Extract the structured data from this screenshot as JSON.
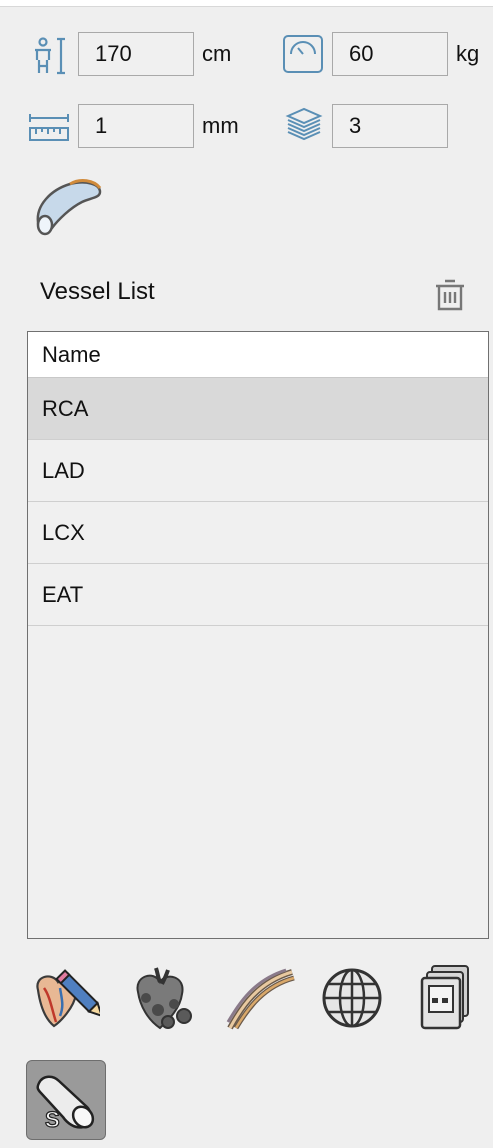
{
  "measurements": {
    "height": {
      "value": "170",
      "unit": "cm"
    },
    "weight": {
      "value": "60",
      "unit": "kg"
    },
    "slice_thickness": {
      "value": "1",
      "unit": "mm"
    },
    "layers": {
      "value": "3"
    }
  },
  "vessel_list": {
    "title": "Vessel List",
    "column_header": "Name",
    "rows": [
      "RCA",
      "LAD",
      "LCX",
      "EAT"
    ],
    "selected_index": 0
  },
  "icons": {
    "height": "body-height-icon",
    "weight": "scale-weight-icon",
    "thickness": "ruler-thickness-icon",
    "layers": "layers-stack-icon",
    "vessel": "vessel-tube-icon",
    "delete": "trash-icon",
    "toolbar": [
      "heart-edit-icon",
      "heart-vessels-icon",
      "vessel-strands-icon",
      "globe-icon",
      "image-stack-icon"
    ],
    "straighten": "straightened-vessel-icon"
  },
  "colors": {
    "panel_bg": "#efefef",
    "field_bg": "#f0f0f0",
    "field_border": "#a9a9a9",
    "selected_row": "#d9d9d9",
    "icon_blue": "#4f8db8"
  }
}
